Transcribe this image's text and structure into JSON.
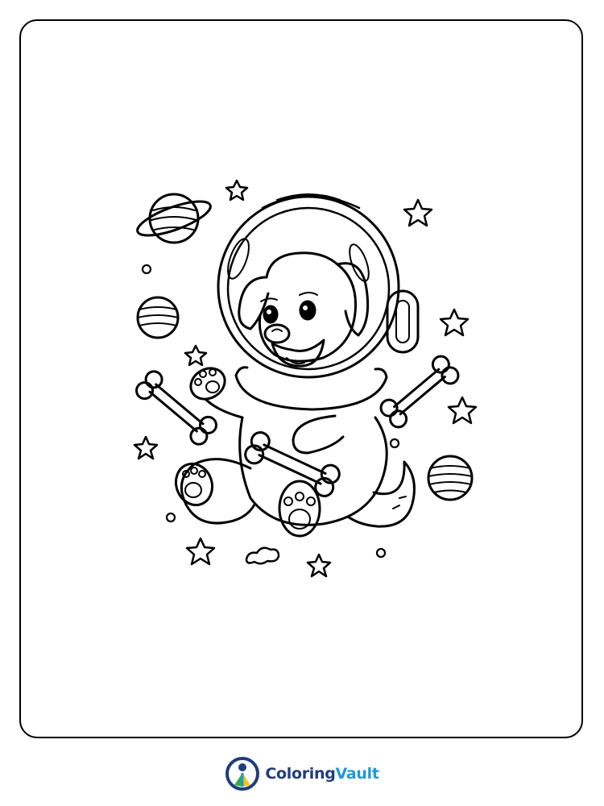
{
  "brand": {
    "name_part1": "Coloring",
    "name_part2": "Vault"
  },
  "illustration": "coloring-page-dog-astronaut",
  "colors": {
    "frame": "#000000",
    "brand_dark": "#1f3d7a",
    "brand_light": "#1e9ad6",
    "logo_green": "#3aa845",
    "logo_yellow": "#f5c518"
  }
}
